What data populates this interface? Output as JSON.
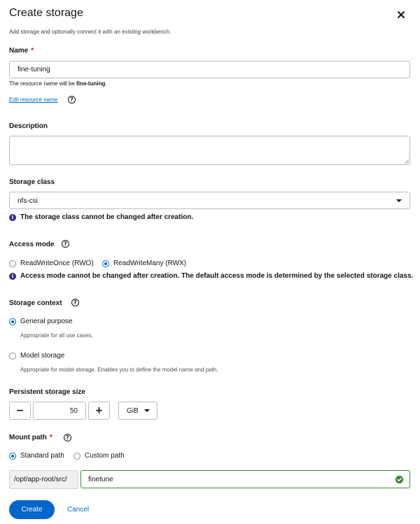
{
  "modal": {
    "title": "Create storage",
    "subtitle": "Add storage and optionally connect it with an existing workbench."
  },
  "name": {
    "label": "Name",
    "required_mark": "*",
    "value": "fine-tuning",
    "hint_prefix": "The resource name will be ",
    "hint_resource": "fine-tuning",
    "hint_suffix": ".",
    "edit_link": "Edit resource name"
  },
  "description": {
    "label": "Description",
    "value": ""
  },
  "storage_class": {
    "label": "Storage class",
    "value": "nfs-csi",
    "info": "The storage class cannot be changed after creation."
  },
  "access_mode": {
    "label": "Access mode",
    "options": [
      "ReadWriteOnce (RWO)",
      "ReadWriteMany (RWX)"
    ],
    "selected": "ReadWriteMany (RWX)",
    "info": "Access mode cannot be changed after creation. The default access mode is determined by the selected storage class."
  },
  "storage_context": {
    "label": "Storage context",
    "options": [
      {
        "label": "General purpose",
        "description": "Appropriate for all use cases."
      },
      {
        "label": "Model storage",
        "description": "Appropriate for model storage. Enables you to define the model name and path."
      }
    ],
    "selected": "General purpose"
  },
  "storage_size": {
    "label": "Persistent storage size",
    "minus": "−",
    "plus": "+",
    "value": "50",
    "unit": "GiB"
  },
  "mount_path": {
    "label": "Mount path",
    "required_mark": "*",
    "options": [
      "Standard path",
      "Custom path"
    ],
    "selected": "Standard path",
    "prefix": "/opt/app-root/src/",
    "value": "finetune"
  },
  "footer": {
    "create_label": "Create",
    "cancel_label": "Cancel"
  },
  "icons": {
    "close": "close-icon",
    "help": "help-icon",
    "info": "info-icon",
    "caret": "caret-down-icon",
    "success": "check-circle-icon"
  },
  "colors": {
    "primary": "#0066cc",
    "required": "#c9190b",
    "success": "#3e8635",
    "info": "#3d2785"
  }
}
